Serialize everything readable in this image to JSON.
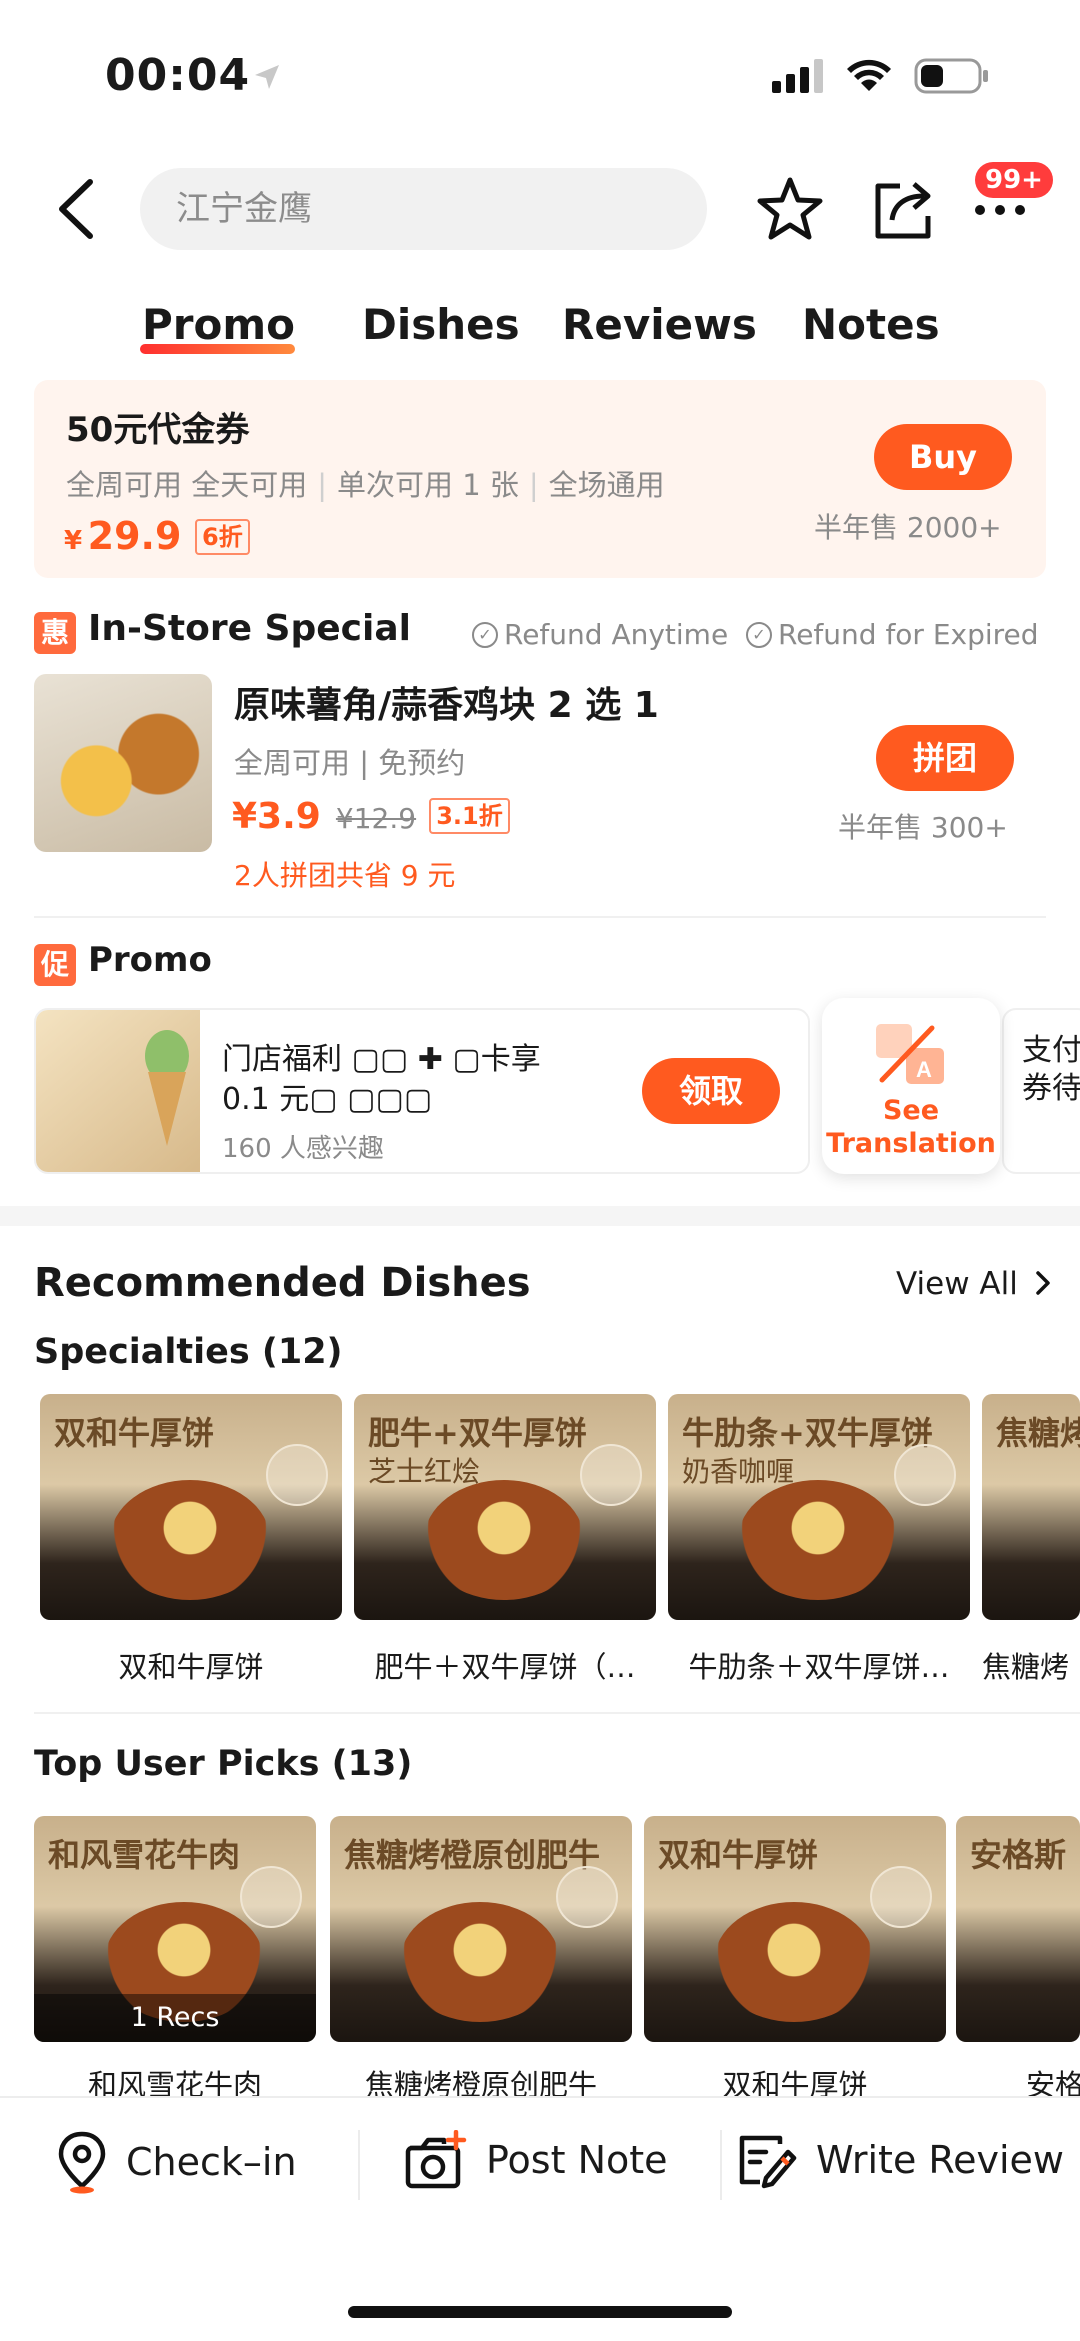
{
  "status": {
    "time": "00:04"
  },
  "header": {
    "search_text": "江宁金鹰",
    "badge": "99+"
  },
  "tabs": [
    {
      "label": "Promo",
      "active": true
    },
    {
      "label": "Dishes"
    },
    {
      "label": "Reviews"
    },
    {
      "label": "Notes"
    }
  ],
  "voucher": {
    "title": "50元代金券",
    "tags": [
      "全周可用 全天可用",
      "单次可用 1 张",
      "全场通用"
    ],
    "price_symbol": "¥",
    "price": "29.9",
    "discount": "6折",
    "buy_label": "Buy",
    "sold": "半年售 2000+"
  },
  "in_store": {
    "icon": "惠",
    "title": "In-Store Special",
    "refund1": "Refund Anytime",
    "refund2": "Refund for Expired",
    "item": {
      "title": "原味薯角/蒜香鸡块 2 选 1",
      "sub": "全周可用 | 免预约",
      "price": "¥3.9",
      "orig_price": "¥12.9",
      "discount": "3.1折",
      "group_note": "2人拼团共省 9 元",
      "button": "拼团",
      "sold": "半年售 300+"
    }
  },
  "promo": {
    "icon": "促",
    "title": "Promo",
    "card": {
      "line1": "门店福利 ▢▢ ✚ ▢卡享",
      "line2": "0.1 元▢ ▢▢▢",
      "interest": "160 人感兴趣",
      "button": "领取"
    },
    "translate_label_1": "See",
    "translate_label_2": "Translation",
    "peek_line1": "支付",
    "peek_line2": "券待"
  },
  "recommended": {
    "title": "Recommended Dishes",
    "view_all": "View All",
    "specialties_title": "Specialties (12)",
    "specialties": [
      {
        "name": "双和牛厚饼",
        "cap": "双和牛厚饼",
        "cap2": ""
      },
      {
        "name": "肥牛＋双牛厚饼（…",
        "cap": "肥牛+双牛厚饼",
        "cap2": "芝士红烩"
      },
      {
        "name": "牛肋条＋双牛厚饼…",
        "cap": "牛肋条+双牛厚饼",
        "cap2": "奶香咖喱"
      },
      {
        "name": "焦糖烤",
        "cap": "焦糖烤",
        "cap2": ""
      }
    ],
    "top_picks_title": "Top User Picks (13)",
    "top_picks": [
      {
        "name": "和风雪花牛肉",
        "cap": "和风雪花牛肉",
        "recs": "1 Recs"
      },
      {
        "name": "焦糖烤橙原创肥牛",
        "cap": "焦糖烤橙原创肥牛",
        "recs": ""
      },
      {
        "name": "双和牛厚饼",
        "cap": "双和牛厚饼",
        "recs": ""
      },
      {
        "name": "安格",
        "cap": "安格斯",
        "recs": ""
      }
    ]
  },
  "bottom_bar": {
    "checkin": "Check–in",
    "post_note": "Post Note",
    "write_review": "Write Review"
  },
  "colors": {
    "accent": "#ff5a1f",
    "muted": "#8a8a8a"
  }
}
